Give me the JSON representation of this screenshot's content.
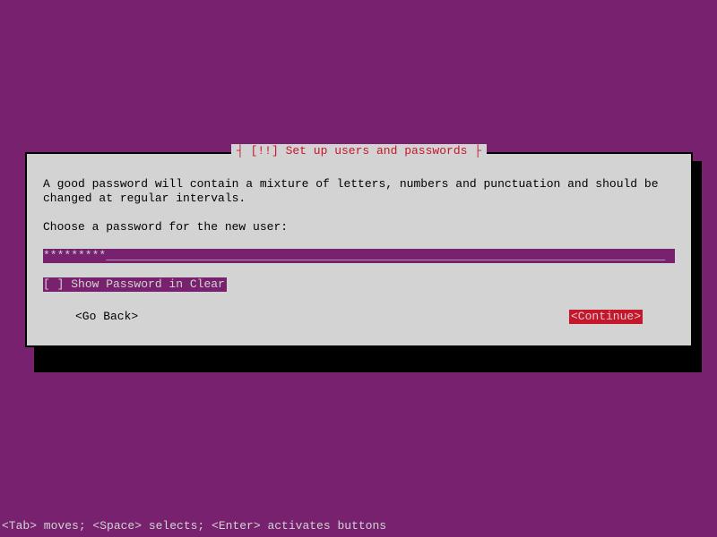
{
  "dialog": {
    "title_prefix": "┤ ",
    "title": "[!!] Set up users and passwords",
    "title_suffix": " ├",
    "description": "A good password will contain a mixture of letters, numbers and punctuation and should be\nchanged at regular intervals.",
    "prompt": "Choose a password for the new user:",
    "password_masked": "*********",
    "password_filler": "________________________________________________________________________________",
    "checkbox": {
      "state": "[ ]",
      "label": "Show Password in Clear"
    },
    "go_back": "<Go Back>",
    "continue": "<Continue>"
  },
  "footer": "<Tab> moves; <Space> selects; <Enter> activates buttons"
}
